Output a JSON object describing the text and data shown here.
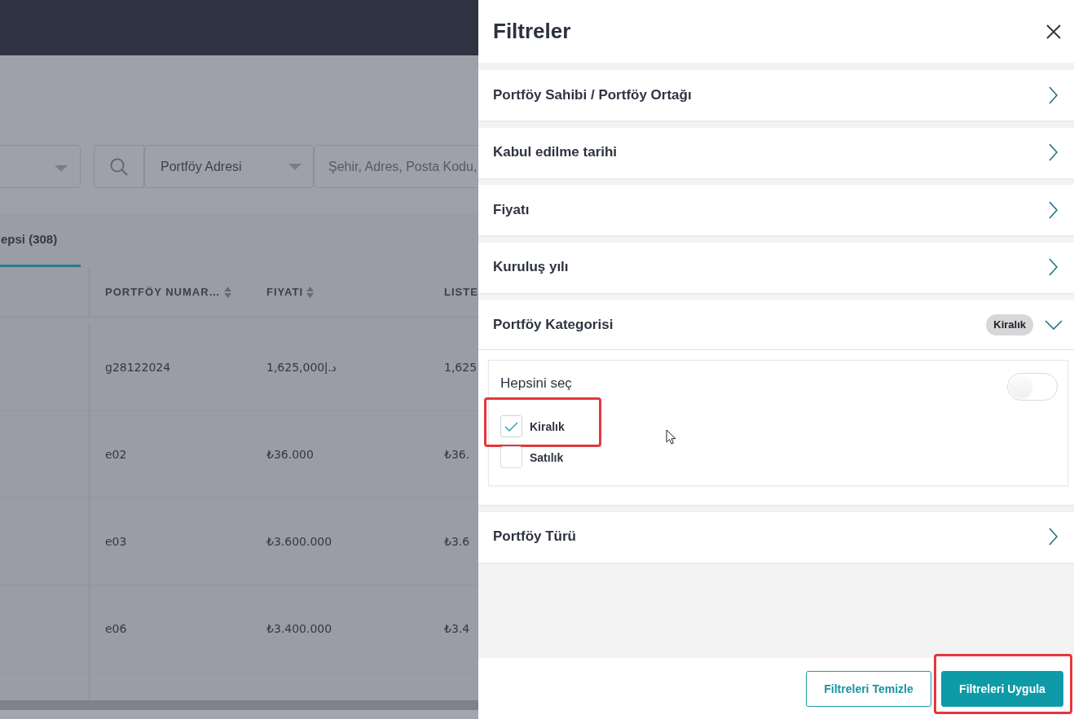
{
  "backdrop": {
    "search": {
      "scope": "Portföy Adresi",
      "placeholder": "Şehir, Adres, Posta Kodu,"
    },
    "tabs": [
      {
        "label": "epsi (308)",
        "selected": true
      }
    ],
    "table": {
      "columns": [
        {
          "label": "PORTFÖY NUMAR…",
          "sortable": true
        },
        {
          "label": "FIYATI",
          "sortable": true
        },
        {
          "label": "LISTE",
          "sortable": false
        }
      ],
      "rows": [
        [
          "g28122024",
          "1,625,000د.إ",
          "1,625"
        ],
        [
          "e02",
          "₺36.000",
          "₺36."
        ],
        [
          "e03",
          "₺3.600.000",
          "₺3.6"
        ],
        [
          "e06",
          "₺3.400.000",
          "₺3.4"
        ]
      ]
    }
  },
  "filter_panel": {
    "title": "Filtreler",
    "sections": [
      {
        "label": "Portföy Sahibi / Portföy Ortağı",
        "expanded": false
      },
      {
        "label": "Kabul edilme tarihi",
        "expanded": false
      },
      {
        "label": "Fiyatı",
        "expanded": false
      },
      {
        "label": "Kuruluş yılı",
        "expanded": false
      },
      {
        "label": "Portföy Kategorisi",
        "expanded": true,
        "badge": "Kiralık",
        "select_all": {
          "label": "Hepsini seç",
          "on": false
        },
        "options": [
          {
            "label": "Kiralık",
            "checked": true,
            "highlighted": true
          },
          {
            "label": "Satılık",
            "checked": false,
            "highlighted": false
          }
        ]
      },
      {
        "label": "Portföy Türü",
        "expanded": false
      }
    ],
    "buttons": [
      {
        "label": "Filtreleri Temizle",
        "kind": "outline",
        "highlighted": false
      },
      {
        "label": "Filtreleri Uygula",
        "kind": "primary",
        "highlighted": true
      }
    ]
  }
}
